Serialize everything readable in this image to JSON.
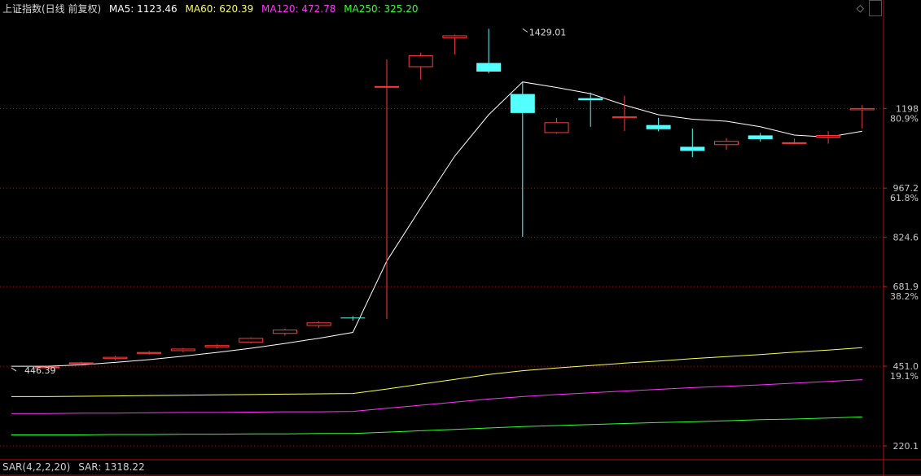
{
  "header": {
    "title": "上证指数(日线 前复权)",
    "ma5": "MA5: 1123.46",
    "ma60": "MA60: 620.39",
    "ma120": "MA120: 472.78",
    "ma250": "MA250: 325.20"
  },
  "footer": {
    "indicator": "SAR(4,2,2,20)",
    "value": "SAR: 1318.22"
  },
  "colors": {
    "up": "#ff3b3b",
    "down": "#54ffff",
    "ma5": "#ffffff",
    "ma60": "#ffff55",
    "ma120": "#ff33ff",
    "ma250": "#33ff33",
    "grid": "#a01010",
    "axis": "#c8c8c8"
  },
  "chart_data": {
    "type": "candlestick",
    "y_range": [
      180,
      1470
    ],
    "y_axis_labels": [
      {
        "value": 1198,
        "label": "1198",
        "pct": "80.9%"
      },
      {
        "value": 967.2,
        "label": "967.2",
        "pct": "61.8%"
      },
      {
        "value": 824.6,
        "label": "824.6",
        "pct": ""
      },
      {
        "value": 681.9,
        "label": "681.9",
        "pct": "38.2%"
      },
      {
        "value": 451.0,
        "label": "451.0",
        "pct": "19.1%"
      },
      {
        "value": 220.1,
        "label": "220.1",
        "pct": ""
      }
    ],
    "annotations": [
      {
        "label": "1429.01",
        "value": 1429.01,
        "index": 14
      },
      {
        "label": "446.39",
        "value": 446.39,
        "index": 0
      }
    ],
    "candles": [
      {
        "o": 447,
        "c": 450,
        "h": 451,
        "l": 446.39
      },
      {
        "o": 457,
        "c": 462,
        "h": 464,
        "l": 455
      },
      {
        "o": 472,
        "c": 478,
        "h": 481,
        "l": 468
      },
      {
        "o": 487,
        "c": 492,
        "h": 495,
        "l": 484
      },
      {
        "o": 495,
        "c": 502,
        "h": 504,
        "l": 492
      },
      {
        "o": 506,
        "c": 512,
        "h": 514,
        "l": 503
      },
      {
        "o": 520,
        "c": 533,
        "h": 535,
        "l": 517
      },
      {
        "o": 545,
        "c": 557,
        "h": 560,
        "l": 540
      },
      {
        "o": 568,
        "c": 578,
        "h": 581,
        "l": 562
      },
      {
        "o": 592,
        "c": 590,
        "h": 596,
        "l": 583
      },
      {
        "o": 1260,
        "c": 1263,
        "h": 1340,
        "l": 588
      },
      {
        "o": 1318,
        "c": 1352,
        "h": 1360,
        "l": 1282
      },
      {
        "o": 1402,
        "c": 1410,
        "h": 1412,
        "l": 1355
      },
      {
        "o": 1330,
        "c": 1305,
        "h": 1429.01,
        "l": 1300
      },
      {
        "o": 1240,
        "c": 1185,
        "h": 1275,
        "l": 826
      },
      {
        "o": 1127,
        "c": 1158,
        "h": 1170,
        "l": 1125
      },
      {
        "o": 1228,
        "c": 1222,
        "h": 1244,
        "l": 1145
      },
      {
        "o": 1170,
        "c": 1175,
        "h": 1235,
        "l": 1133
      },
      {
        "o": 1150,
        "c": 1138,
        "h": 1171,
        "l": 1132
      },
      {
        "o": 1087,
        "c": 1075,
        "h": 1140,
        "l": 1057
      },
      {
        "o": 1092,
        "c": 1104,
        "h": 1112,
        "l": 1078
      },
      {
        "o": 1120,
        "c": 1109,
        "h": 1127,
        "l": 1102
      },
      {
        "o": 1097,
        "c": 1100,
        "h": 1111,
        "l": 1094
      },
      {
        "o": 1114,
        "c": 1121,
        "h": 1132,
        "l": 1096
      },
      {
        "o": 1193,
        "c": 1199,
        "h": 1208,
        "l": 1140
      }
    ],
    "ma5": [
      451,
      455,
      462,
      470,
      480,
      491,
      503,
      517,
      532,
      549,
      756,
      910,
      1060,
      1180,
      1275,
      1259,
      1241,
      1208,
      1180,
      1167,
      1161,
      1145,
      1121,
      1115,
      1132
    ],
    "ma60": [
      363,
      364,
      365,
      366,
      367,
      368,
      369,
      370,
      371,
      372,
      385,
      399,
      413,
      427,
      438,
      446,
      453,
      460,
      466,
      473,
      479,
      485,
      492,
      498,
      505
    ],
    "ma120": [
      314,
      315,
      315,
      316,
      317,
      317,
      318,
      319,
      319,
      320,
      329,
      338,
      347,
      356,
      363,
      369,
      374,
      379,
      384,
      389,
      393,
      397,
      402,
      407,
      412
    ],
    "ma250": [
      252,
      252,
      253,
      253,
      254,
      254,
      255,
      255,
      256,
      256,
      260,
      264,
      268,
      272,
      276,
      279,
      282,
      285,
      288,
      290,
      293,
      296,
      298,
      301,
      304
    ]
  }
}
